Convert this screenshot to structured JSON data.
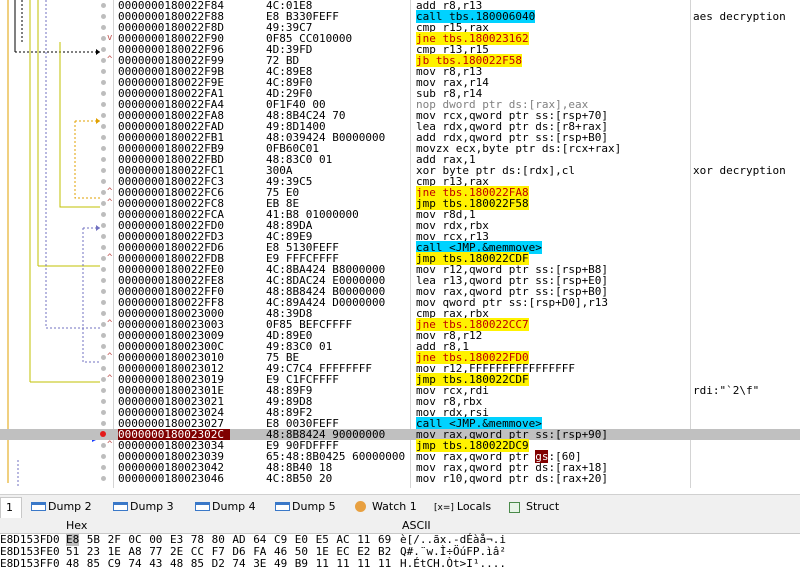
{
  "disassembly": {
    "rows": [
      {
        "addr": "0000000180022F84",
        "bytes": "4C:01E8",
        "ins": [
          [
            "add r8,r13",
            ""
          ]
        ],
        "cmt": "",
        "arrow": "",
        "bp": "dot"
      },
      {
        "addr": "0000000180022F88",
        "bytes": "E8 B330FEFF",
        "ins": [
          [
            "call tbs.180006040",
            "call"
          ]
        ],
        "cmt": "aes decryption",
        "arrow": "",
        "bp": "dot"
      },
      {
        "addr": "0000000180022F8D",
        "bytes": "49:39C7",
        "ins": [
          [
            "cmp r15,rax",
            ""
          ]
        ],
        "cmt": "",
        "arrow": "",
        "bp": "dot"
      },
      {
        "addr": "0000000180022F90",
        "bytes": "0F85 CC010000",
        "ins": [
          [
            "jne tbs.180023162",
            "jcc"
          ]
        ],
        "cmt": "",
        "arrow": "v",
        "bp": "dot"
      },
      {
        "addr": "0000000180022F96",
        "bytes": "4D:39FD",
        "ins": [
          [
            "cmp r13,r15",
            ""
          ]
        ],
        "cmt": "",
        "arrow": "",
        "bp": "dot"
      },
      {
        "addr": "0000000180022F99",
        "bytes": "72 BD",
        "ins": [
          [
            "jb tbs.180022F58",
            "jcc"
          ]
        ],
        "cmt": "",
        "arrow": "^",
        "bp": "dot"
      },
      {
        "addr": "0000000180022F9B",
        "bytes": "4C:89E8",
        "ins": [
          [
            "mov r8,r13",
            ""
          ]
        ],
        "cmt": "",
        "arrow": "",
        "bp": "dot"
      },
      {
        "addr": "0000000180022F9E",
        "bytes": "4C:89F0",
        "ins": [
          [
            "mov rax,r14",
            ""
          ]
        ],
        "cmt": "",
        "arrow": "",
        "bp": "dot"
      },
      {
        "addr": "0000000180022FA1",
        "bytes": "4D:29F0",
        "ins": [
          [
            "sub r8,r14",
            ""
          ]
        ],
        "cmt": "",
        "arrow": "",
        "bp": "dot"
      },
      {
        "addr": "0000000180022FA4",
        "bytes": "0F1F40 00",
        "ins": [
          [
            "nop dword ptr ds:[rax],eax",
            "nop"
          ]
        ],
        "cmt": "",
        "arrow": "",
        "bp": "dot"
      },
      {
        "addr": "0000000180022FA8",
        "bytes": "48:8B4C24 70",
        "ins": [
          [
            "mov rcx,qword ptr ss:[rsp+70]",
            ""
          ]
        ],
        "cmt": "",
        "arrow": "",
        "bp": "dot"
      },
      {
        "addr": "0000000180022FAD",
        "bytes": "49:8D1400",
        "ins": [
          [
            "lea rdx,qword ptr ds:[r8+rax]",
            ""
          ]
        ],
        "cmt": "",
        "arrow": "",
        "bp": "dot"
      },
      {
        "addr": "0000000180022FB1",
        "bytes": "48:039424 B0000000",
        "ins": [
          [
            "add rdx,qword ptr ss:[rsp+B0]",
            ""
          ]
        ],
        "cmt": "",
        "arrow": "",
        "bp": "dot"
      },
      {
        "addr": "0000000180022FB9",
        "bytes": "0FB60C01",
        "ins": [
          [
            "movzx ecx,byte ptr ds:[rcx+rax]",
            ""
          ]
        ],
        "cmt": "",
        "arrow": "",
        "bp": "dot"
      },
      {
        "addr": "0000000180022FBD",
        "bytes": "48:83C0 01",
        "ins": [
          [
            "add rax,1",
            ""
          ]
        ],
        "cmt": "",
        "arrow": "",
        "bp": "dot"
      },
      {
        "addr": "0000000180022FC1",
        "bytes": "300A",
        "ins": [
          [
            "xor byte ptr ds:[rdx],cl",
            ""
          ]
        ],
        "cmt": "xor decryption",
        "arrow": "",
        "bp": "dot"
      },
      {
        "addr": "0000000180022FC3",
        "bytes": "49:39C5",
        "ins": [
          [
            "cmp r13,rax",
            ""
          ]
        ],
        "cmt": "",
        "arrow": "",
        "bp": "dot"
      },
      {
        "addr": "0000000180022FC6",
        "bytes": "75 E0",
        "ins": [
          [
            "jne tbs.180022FA8",
            "jcc"
          ]
        ],
        "cmt": "",
        "arrow": "^",
        "bp": "dot"
      },
      {
        "addr": "0000000180022FC8",
        "bytes": "EB 8E",
        "ins": [
          [
            "jmp tbs.180022F58",
            "jmp"
          ]
        ],
        "cmt": "",
        "arrow": "^",
        "bp": "dot"
      },
      {
        "addr": "0000000180022FCA",
        "bytes": "41:B8 01000000",
        "ins": [
          [
            "mov r8d,1",
            ""
          ]
        ],
        "cmt": "",
        "arrow": "",
        "bp": "dot"
      },
      {
        "addr": "0000000180022FD0",
        "bytes": "48:89DA",
        "ins": [
          [
            "mov rdx,rbx",
            ""
          ]
        ],
        "cmt": "",
        "arrow": "",
        "bp": "dot"
      },
      {
        "addr": "0000000180022FD3",
        "bytes": "4C:89E9",
        "ins": [
          [
            "mov rcx,r13",
            ""
          ]
        ],
        "cmt": "",
        "arrow": "",
        "bp": "dot"
      },
      {
        "addr": "0000000180022FD6",
        "bytes": "E8 5130FEFF",
        "ins": [
          [
            "call <JMP.&memmove>",
            "call"
          ]
        ],
        "cmt": "",
        "arrow": "",
        "bp": "dot"
      },
      {
        "addr": "0000000180022FDB",
        "bytes": "E9 FFFCFFFF",
        "ins": [
          [
            "jmp tbs.180022CDF",
            "jmp"
          ]
        ],
        "cmt": "",
        "arrow": "^",
        "bp": "dot"
      },
      {
        "addr": "0000000180022FE0",
        "bytes": "4C:8BA424 B8000000",
        "ins": [
          [
            "mov r12,qword ptr ss:[rsp+B8]",
            ""
          ]
        ],
        "cmt": "",
        "arrow": "",
        "bp": "dot"
      },
      {
        "addr": "0000000180022FE8",
        "bytes": "4C:8DAC24 E0000000",
        "ins": [
          [
            "lea r13,qword ptr ss:[rsp+E0]",
            ""
          ]
        ],
        "cmt": "",
        "arrow": "",
        "bp": "dot"
      },
      {
        "addr": "0000000180022FF0",
        "bytes": "48:8B8424 B0000000",
        "ins": [
          [
            "mov rax,qword ptr ss:[rsp+B0]",
            ""
          ]
        ],
        "cmt": "",
        "arrow": "",
        "bp": "dot"
      },
      {
        "addr": "0000000180022FF8",
        "bytes": "4C:89A424 D0000000",
        "ins": [
          [
            "mov qword ptr ss:[rsp+D0],r13",
            ""
          ]
        ],
        "cmt": "",
        "arrow": "",
        "bp": "dot"
      },
      {
        "addr": "0000000180023000",
        "bytes": "48:39D8",
        "ins": [
          [
            "cmp rax,rbx",
            ""
          ]
        ],
        "cmt": "",
        "arrow": "",
        "bp": "dot"
      },
      {
        "addr": "0000000180023003",
        "bytes": "0F85 BEFCFFFF",
        "ins": [
          [
            "jne tbs.180022CC7",
            "jcc"
          ]
        ],
        "cmt": "",
        "arrow": "^",
        "bp": "dot"
      },
      {
        "addr": "0000000180023009",
        "bytes": "4D:89E0",
        "ins": [
          [
            "mov r8,r12",
            ""
          ]
        ],
        "cmt": "",
        "arrow": "",
        "bp": "dot"
      },
      {
        "addr": "000000018002300C",
        "bytes": "49:83C0 01",
        "ins": [
          [
            "add r8,1",
            ""
          ]
        ],
        "cmt": "",
        "arrow": "",
        "bp": "dot"
      },
      {
        "addr": "0000000180023010",
        "bytes": "75 BE",
        "ins": [
          [
            "jne tbs.180022FD0",
            "jcc"
          ]
        ],
        "cmt": "",
        "arrow": "^",
        "bp": "dot"
      },
      {
        "addr": "0000000180023012",
        "bytes": "49:C7C4 FFFFFFFF",
        "ins": [
          [
            "mov r12,FFFFFFFFFFFFFFFF",
            ""
          ]
        ],
        "cmt": "",
        "arrow": "",
        "bp": "dot"
      },
      {
        "addr": "0000000180023019",
        "bytes": "E9 C1FCFFFF",
        "ins": [
          [
            "jmp tbs.180022CDF",
            "jmp"
          ]
        ],
        "cmt": "",
        "arrow": "^",
        "bp": "dot"
      },
      {
        "addr": "000000018002301E",
        "bytes": "48:89F9",
        "ins": [
          [
            "mov rcx,rdi",
            ""
          ]
        ],
        "cmt": "rdi:\"`2\\f\"",
        "arrow": "",
        "bp": "dot"
      },
      {
        "addr": "0000000180023021",
        "bytes": "49:89D8",
        "ins": [
          [
            "mov r8,rbx",
            ""
          ]
        ],
        "cmt": "",
        "arrow": "",
        "bp": "dot"
      },
      {
        "addr": "0000000180023024",
        "bytes": "48:89F2",
        "ins": [
          [
            "mov rdx,rsi",
            ""
          ]
        ],
        "cmt": "",
        "arrow": "",
        "bp": "dot"
      },
      {
        "addr": "0000000180023027",
        "bytes": "E8 0030FEFF",
        "ins": [
          [
            "call <JMP.&memmove>",
            "call"
          ]
        ],
        "cmt": "",
        "arrow": "",
        "bp": "dot"
      },
      {
        "addr": "000000018002302C",
        "bytes": "48:8B8424 90000000",
        "ins": [
          [
            "mov rax,qword ptr ss:[rsp+90]",
            ""
          ]
        ],
        "cmt": "",
        "arrow": "",
        "bp": "active",
        "current": true
      },
      {
        "addr": "0000000180023034",
        "bytes": "E9 90FDFFFF",
        "ins": [
          [
            "jmp tbs.180022DC9",
            "jmp"
          ]
        ],
        "cmt": "",
        "arrow": "^",
        "bp": "dot"
      },
      {
        "addr": "0000000180023039",
        "bytes": "65:48:8B0425 60000000",
        "ins": [
          [
            "mov rax,qword ptr ",
            ""
          ],
          [
            "gs",
            "gs"
          ],
          [
            ":[60]",
            ""
          ]
        ],
        "cmt": "",
        "arrow": "",
        "bp": "dot"
      },
      {
        "addr": "0000000180023042",
        "bytes": "48:8B40 18",
        "ins": [
          [
            "mov rax,qword ptr ds:[rax+18]",
            ""
          ]
        ],
        "cmt": "",
        "arrow": "",
        "bp": "dot"
      },
      {
        "addr": "0000000180023046",
        "bytes": "4C:8B50 20",
        "ins": [
          [
            "mov r10,qword ptr ds:[rax+20]",
            ""
          ]
        ],
        "cmt": "",
        "arrow": "",
        "bp": "dot"
      }
    ]
  },
  "tabs": [
    {
      "label": "1",
      "icon": "dump-icon"
    },
    {
      "label": "Dump 2",
      "icon": "dump-icon"
    },
    {
      "label": "Dump 3",
      "icon": "dump-icon"
    },
    {
      "label": "Dump 4",
      "icon": "dump-icon"
    },
    {
      "label": "Dump 5",
      "icon": "dump-icon"
    },
    {
      "label": "Watch 1",
      "icon": "watch-icon"
    },
    {
      "label": "Locals",
      "icon": "locals-icon",
      "prefix": "[x=]"
    },
    {
      "label": "Struct",
      "icon": "struct-icon"
    }
  ],
  "hex": {
    "header_address": "",
    "header_hex": "Hex",
    "header_ascii": "ASCII",
    "rows": [
      {
        "addr": "E8D153FD0",
        "bytes": [
          "E8",
          "5B",
          "2F",
          "0C",
          "00",
          "E3",
          "78",
          "80",
          "AD",
          "64",
          "C9",
          "E0",
          "E5",
          "AC",
          "11",
          "69"
        ],
        "ascii": "è[/..ãx.-dÉàå¬.i"
      },
      {
        "addr": "E8D153FE0",
        "bytes": [
          "51",
          "23",
          "1E",
          "A8",
          "77",
          "2E",
          "CC",
          "F7",
          "D6",
          "FA",
          "46",
          "50",
          "1E",
          "EC",
          "E2",
          "B2"
        ],
        "ascii": "Q#.¨w.Ì÷ÖúFP.ìâ²"
      },
      {
        "addr": "E8D153FF0",
        "bytes": [
          "48",
          "85",
          "C9",
          "74",
          "43",
          "48",
          "85",
          "D2",
          "74",
          "3E",
          "49",
          "B9",
          "11",
          "11",
          "11",
          "11"
        ],
        "ascii": "H.ÉtCH.Òt>I¹...."
      }
    ]
  },
  "colors": {
    "call_bg": "#00d2ff",
    "jmp_bg": "#fff200",
    "jcc_fg": "#c00000",
    "current_addr_bg": "#800000",
    "breakpoint": "#e31a1a",
    "eip_arrow": "#1a3cff"
  }
}
